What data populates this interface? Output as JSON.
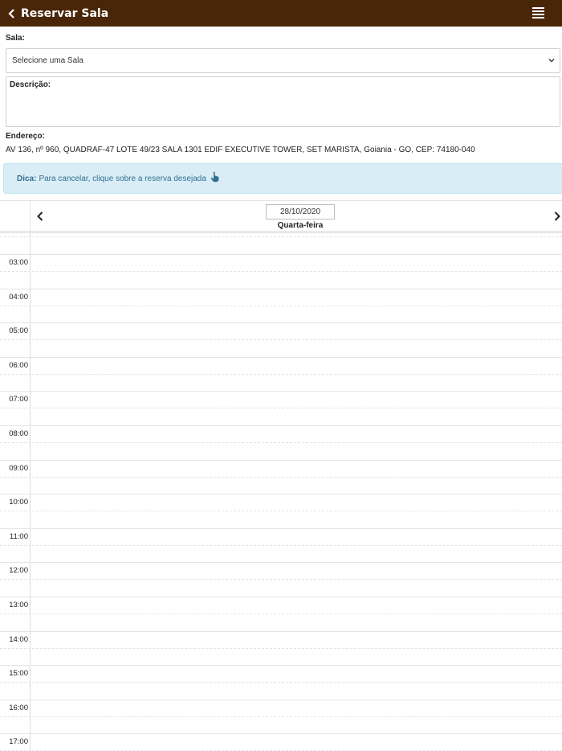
{
  "header": {
    "title": "Reservar Sala",
    "bg_color": "#4a2608"
  },
  "form": {
    "room_label": "Sala:",
    "room_select_value": "Selecione uma Sala",
    "description_label": "Descrição:",
    "address_label": "Endereço:",
    "address_value": "AV 136, nº 960, QUADRAF-47 LOTE 49/23 SALA 1301 EDIF EXECUTIVE TOWER, SET MARISTA, Goiania - GO, CEP: 74180-040"
  },
  "tip": {
    "prefix": "Dica:",
    "text": "Para cancelar, clique sobre a reserva desejada",
    "icon": "pointing-hand-icon"
  },
  "calendar": {
    "date": "28/10/2020",
    "weekday": "Quarta-feira",
    "hours": [
      "03:00",
      "04:00",
      "05:00",
      "06:00",
      "07:00",
      "08:00",
      "09:00",
      "10:00",
      "11:00",
      "12:00",
      "13:00",
      "14:00",
      "15:00",
      "16:00",
      "17:00"
    ]
  }
}
